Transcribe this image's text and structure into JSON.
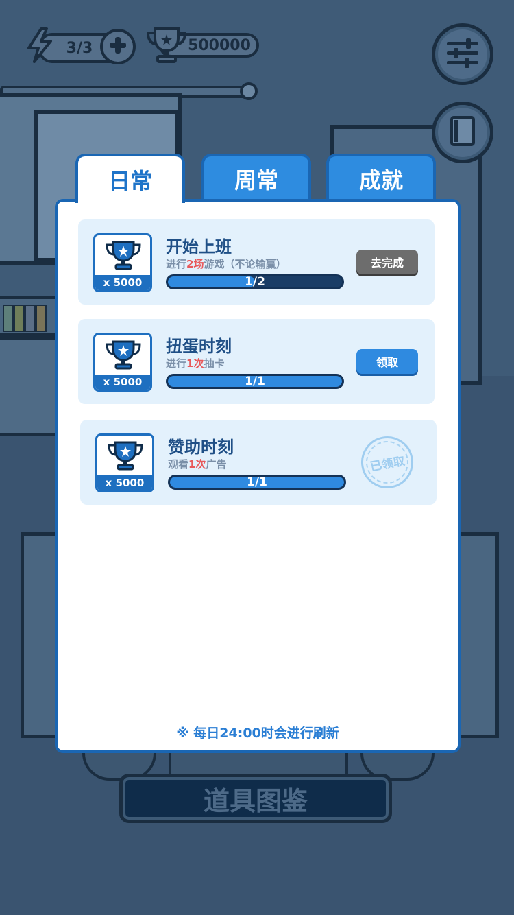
{
  "hud": {
    "energy_text": "3/3",
    "trophy_text": "500000"
  },
  "tabs": {
    "daily": "日常",
    "weekly": "周常",
    "achievement": "成就"
  },
  "tasks": [
    {
      "title": "开始上班",
      "desc_prefix": "进行",
      "desc_highlight": "2场",
      "desc_suffix": "游戏（不论输赢）",
      "reward": "x 5000",
      "progress_text": "1/2",
      "progress": 0.5,
      "action": "去完成"
    },
    {
      "title": "扭蛋时刻",
      "desc_prefix": "进行",
      "desc_highlight": "1次",
      "desc_suffix": "抽卡",
      "reward": "x 5000",
      "progress_text": "1/1",
      "progress": 1.0,
      "action": "领取"
    },
    {
      "title": "赞助时刻",
      "desc_prefix": "观看",
      "desc_highlight": "1次",
      "desc_suffix": "广告",
      "reward": "x 5000",
      "progress_text": "1/1",
      "progress": 1.0,
      "action": "已领取"
    }
  ],
  "footer_note": "※ 每日24:00时会进行刷新",
  "bottom_button": "道具图鉴",
  "colors": {
    "accent": "#2f8ae0",
    "tab_border": "#1a66b3",
    "highlight": "#e8595b",
    "task_bg": "#e3f1fc"
  },
  "icons": {
    "energy": "lightning-icon",
    "plus": "plus-icon",
    "trophy": "trophy-icon",
    "settings": "sliders-icon",
    "book": "book-icon"
  }
}
